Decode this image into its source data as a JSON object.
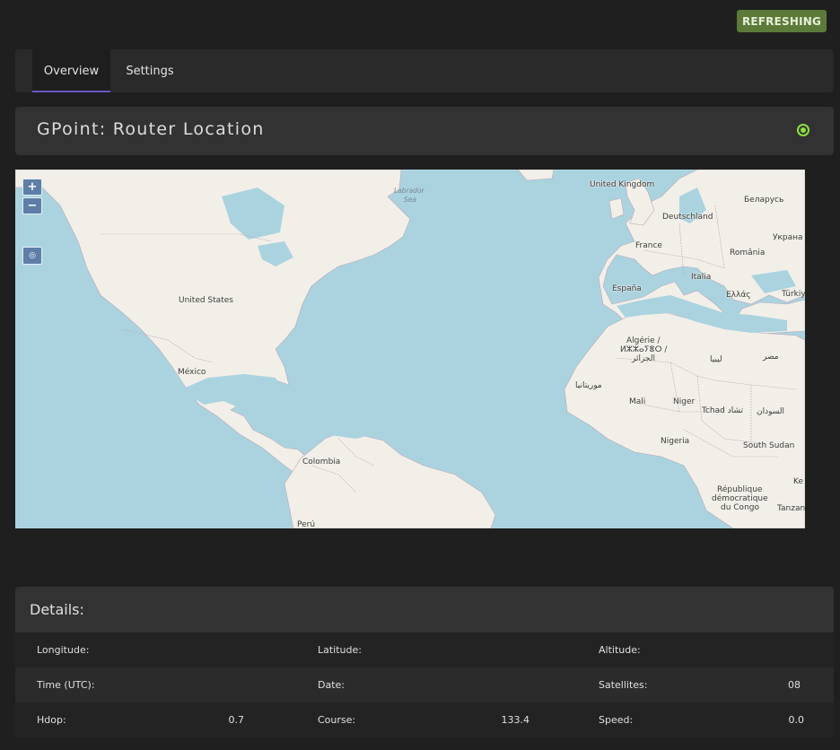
{
  "status_badge": "REFRESHING",
  "tabs": [
    {
      "label": "Overview",
      "active": true
    },
    {
      "label": "Settings",
      "active": false
    }
  ],
  "page_title": "GPoint: Router Location",
  "map": {
    "zoom_in": "+",
    "zoom_out": "−",
    "labels": {
      "labrador_sea_1": "Labrador",
      "labrador_sea_2": "Sea",
      "united_kingdom": "United Kingdom",
      "belarus": "Беларусь",
      "deutschland": "Deutschland",
      "ukraine": "Украна",
      "france": "France",
      "romania": "România",
      "italia": "Italia",
      "espana": "España",
      "ellas": "Ελλάς",
      "turkiye": "Türkiy",
      "united_states": "United States",
      "algerie_1": "Algérie /",
      "algerie_2": "ⵍⵣⵣⴰⵢⴻⵔ /",
      "algerie_3": "الجزائر",
      "libya": "ليبيا",
      "egypt": "مصر",
      "mexico": "México",
      "mauritania": "موريتانيا",
      "mali": "Mali",
      "niger": "Niger",
      "tchad": "Tchad تشاد",
      "sudan": "السودان",
      "nigeria": "Nigeria",
      "south_sudan": "South Sudan",
      "colombia": "Colombia",
      "drc_1": "République",
      "drc_2": "démocratique",
      "drc_3": "du Congo",
      "tanzania": "Tanzan",
      "peru": "Perú",
      "kenya": "Ke"
    }
  },
  "details": {
    "title": "Details:",
    "rows": [
      [
        {
          "label": "Longitude:",
          "value": ""
        },
        {
          "label": "Latitude:",
          "value": ""
        },
        {
          "label": "Altitude:",
          "value": ""
        }
      ],
      [
        {
          "label": "Time (UTC):",
          "value": ""
        },
        {
          "label": "Date:",
          "value": ""
        },
        {
          "label": "Satellites:",
          "value": "08"
        }
      ],
      [
        {
          "label": "Hdop:",
          "value": "0.7"
        },
        {
          "label": "Course:",
          "value": "133.4"
        },
        {
          "label": "Speed:",
          "value": "0.0"
        }
      ]
    ]
  },
  "colors": {
    "accent_tab": "#6a55c7",
    "status_green": "#8fe03e",
    "badge_bg": "#5c7a3a",
    "ocean": "#aad3df",
    "land": "#f2efe9"
  }
}
